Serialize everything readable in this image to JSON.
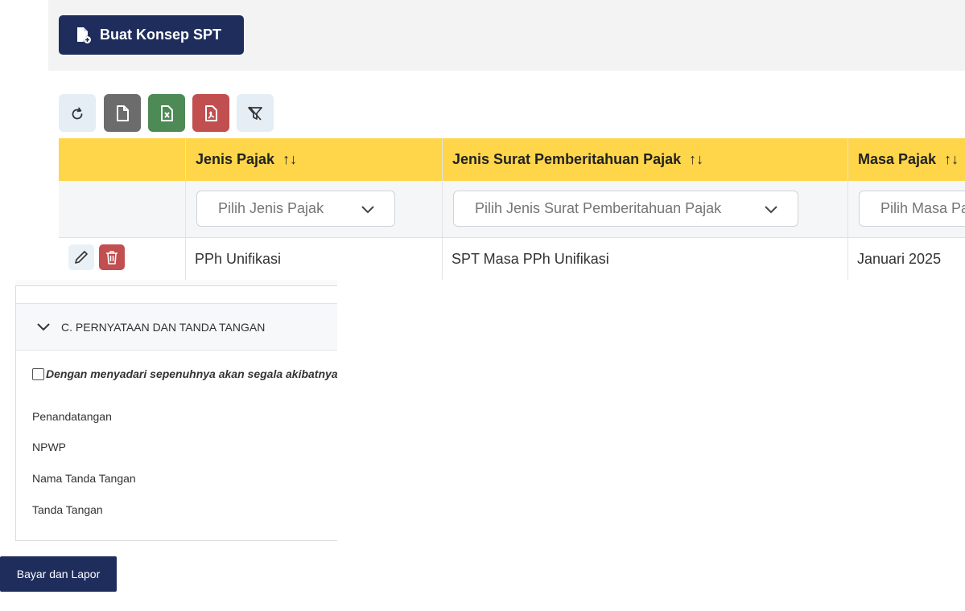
{
  "top": {
    "create_button": "Buat Konsep SPT"
  },
  "toolbar": {
    "refresh": "refresh-icon",
    "file": "file-icon",
    "excel": "excel-icon",
    "pdf": "pdf-icon",
    "filter": "filter-clear-icon"
  },
  "table": {
    "columns": [
      {
        "label": "Jenis Pajak",
        "sort": "↑↓",
        "filter_placeholder": "Pilih Jenis Pajak"
      },
      {
        "label": "Jenis Surat Pemberitahuan Pajak",
        "sort": "↑↓",
        "filter_placeholder": "Pilih Jenis Surat Pemberitahuan Pajak"
      },
      {
        "label": "Masa Pajak",
        "sort": "↑↓",
        "filter_placeholder": "Pilih Masa Pajak"
      }
    ],
    "rows": [
      {
        "jenis_pajak": "PPh Unifikasi",
        "jenis_spt": "SPT Masa PPh Unifikasi",
        "masa_pajak": "Januari 2025"
      }
    ]
  },
  "section": {
    "title": "C. PERNYATAAN DAN TANDA TANGAN",
    "statement": "Dengan menyadari sepenuhnya akan segala akibatnya",
    "fields": [
      "Penandatangan",
      "NPWP",
      "Nama Tanda Tangan",
      "Tanda Tangan"
    ]
  },
  "footer": {
    "submit_button": "Bayar dan Lapor"
  },
  "colors": {
    "primary": "#1e2d5c",
    "header_yellow": "#ffd54a",
    "danger": "#c24f4f",
    "success": "#4e8a55",
    "secondary": "#6c6c6c"
  }
}
